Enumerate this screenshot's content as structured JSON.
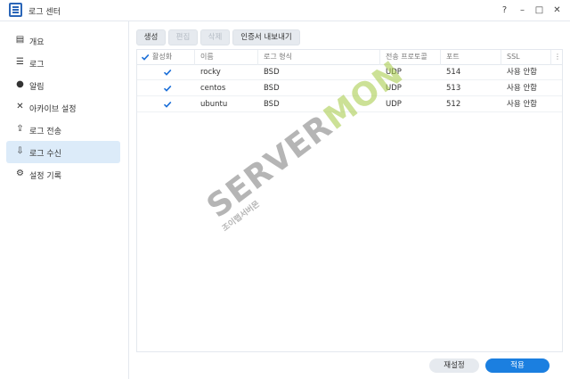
{
  "window": {
    "title": "로그 센터",
    "controls": [
      "?",
      "–",
      "□",
      "✕"
    ]
  },
  "sidebar": {
    "items": [
      {
        "label": "개요",
        "icon": "overview-icon",
        "glyph": "▤"
      },
      {
        "label": "로그",
        "icon": "log-list-icon",
        "glyph": "☰"
      },
      {
        "label": "알림",
        "icon": "notification-icon",
        "glyph": "●"
      },
      {
        "label": "아카이브 설정",
        "icon": "archive-settings-icon",
        "glyph": "✕"
      },
      {
        "label": "로그 전송",
        "icon": "log-send-icon",
        "glyph": "⇪"
      },
      {
        "label": "로그 수신",
        "icon": "log-receive-icon",
        "glyph": "⇩"
      },
      {
        "label": "설정 기록",
        "icon": "settings-history-icon",
        "glyph": "⚙"
      }
    ],
    "active_index": 5
  },
  "toolbar": {
    "create": "생성",
    "edit": "편집",
    "delete": "삭제",
    "export_cert": "인증서 내보내기"
  },
  "table": {
    "headers": {
      "enabled": "활성화",
      "name": "이름",
      "format": "로그 형식",
      "protocol": "전송 프로토콜",
      "port": "포트",
      "ssl": "SSL",
      "menu": "⋮"
    },
    "rows": [
      {
        "enabled": true,
        "name": "rocky",
        "format": "BSD",
        "protocol": "UDP",
        "port": "514",
        "ssl": "사용 안함"
      },
      {
        "enabled": true,
        "name": "centos",
        "format": "BSD",
        "protocol": "UDP",
        "port": "513",
        "ssl": "사용 안함"
      },
      {
        "enabled": true,
        "name": "ubuntu",
        "format": "BSD",
        "protocol": "UDP",
        "port": "512",
        "ssl": "사용 안함"
      }
    ]
  },
  "watermark": {
    "text_a": "SERVER",
    "text_b": "MON",
    "sub": "조이랩서버몬"
  },
  "footer": {
    "reset": "재설정",
    "apply": "적용"
  },
  "colors": {
    "accent": "#1b7fe0",
    "active_sidebar": "#dcebf9",
    "check": "#1b6fd8"
  }
}
